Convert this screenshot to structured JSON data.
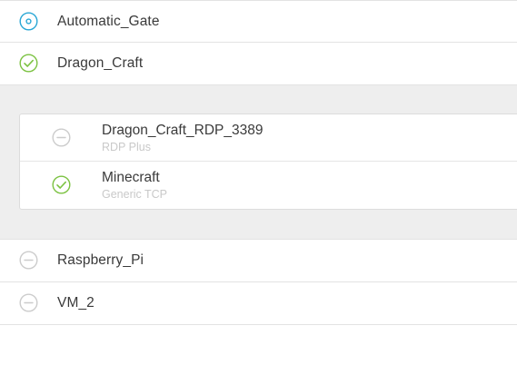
{
  "colors": {
    "online": "#7cc242",
    "offline": "#cccccc",
    "pending": "#2aa7d5",
    "expanded_bg": "#eeeeee"
  },
  "devices": [
    {
      "label": "Automatic_Gate",
      "status_icon": "radio-target-icon"
    },
    {
      "label": "Dragon_Craft",
      "status_icon": "check-circle-icon"
    },
    {
      "label": "Raspberry_Pi",
      "status_icon": "minus-circle-icon"
    },
    {
      "label": "VM_2",
      "status_icon": "minus-circle-icon"
    }
  ],
  "services": [
    {
      "name": "Dragon_Craft_RDP_3389",
      "type": "RDP Plus",
      "status_icon": "minus-circle-icon"
    },
    {
      "name": "Minecraft",
      "type": "Generic TCP",
      "status_icon": "check-circle-icon"
    }
  ]
}
